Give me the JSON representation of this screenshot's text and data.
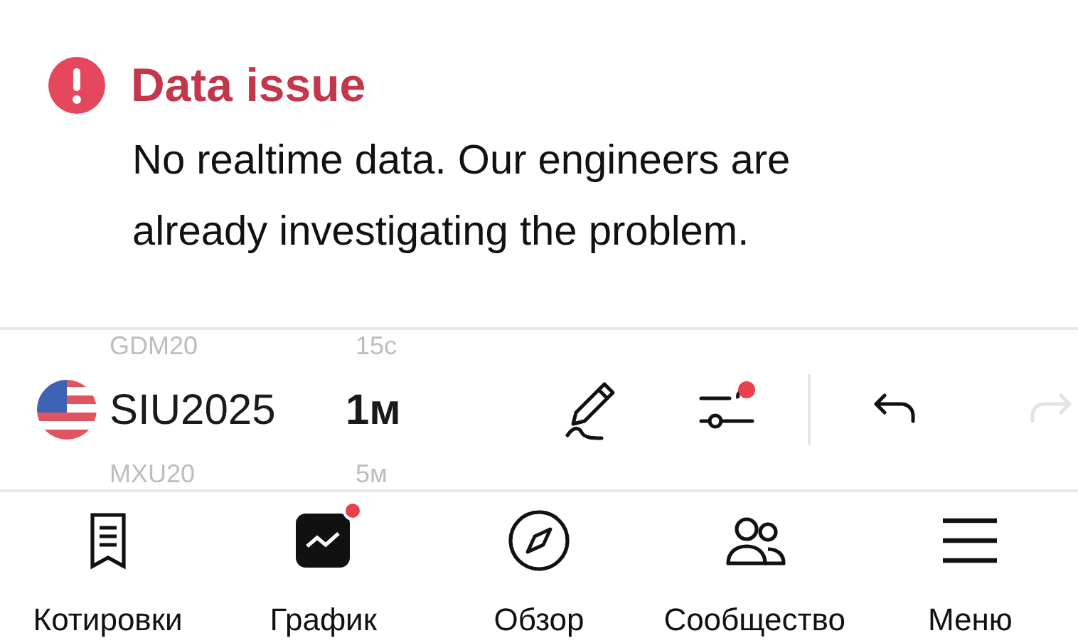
{
  "alert": {
    "title": "Data issue",
    "message": "No realtime data. Our engineers are already investigating the problem."
  },
  "symbol_picker": [
    {
      "symbol": "GDM20",
      "interval": "15c",
      "selected": false
    },
    {
      "symbol": "SIU2025",
      "interval": "1м",
      "selected": true
    },
    {
      "symbol": "MXU20",
      "interval": "5м",
      "selected": false
    }
  ],
  "toolbar": [
    {
      "kind": "draw",
      "badge": false,
      "disabled": false
    },
    {
      "kind": "settings",
      "badge": true,
      "disabled": false
    },
    {
      "kind": "undo",
      "badge": false,
      "disabled": false
    },
    {
      "kind": "redo",
      "badge": false,
      "disabled": true
    }
  ],
  "bottom_nav": [
    {
      "kind": "quotes",
      "label": "Котировки",
      "selected": false,
      "badge": false
    },
    {
      "kind": "chart",
      "label": "График",
      "selected": true,
      "badge": true
    },
    {
      "kind": "explore",
      "label": "Обзор",
      "selected": false,
      "badge": false
    },
    {
      "kind": "community",
      "label": "Сообщество",
      "selected": false,
      "badge": false
    },
    {
      "kind": "menu",
      "label": "Меню",
      "selected": false,
      "badge": false
    }
  ]
}
